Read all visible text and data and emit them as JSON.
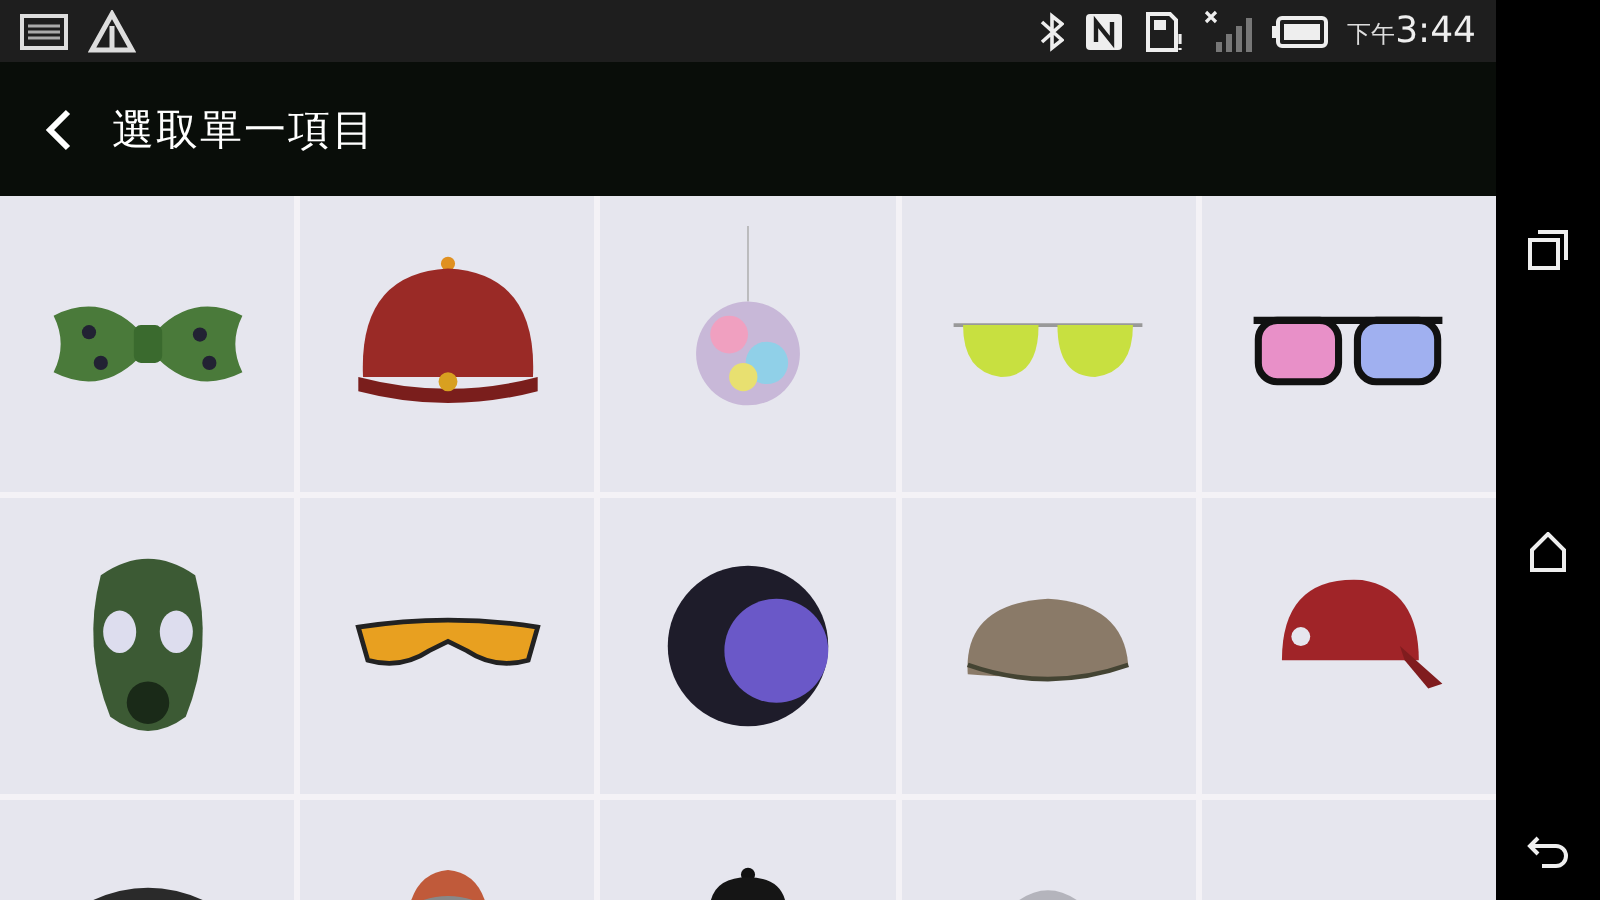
{
  "status_bar": {
    "period": "下午",
    "time": "3:44"
  },
  "app_bar": {
    "title": "選取單一項目"
  },
  "items": [
    {
      "kind": "bowtie"
    },
    {
      "kind": "skullcap"
    },
    {
      "kind": "discoball"
    },
    {
      "kind": "aviators"
    },
    {
      "kind": "pinkglasses"
    },
    {
      "kind": "gasmask"
    },
    {
      "kind": "sportglasses"
    },
    {
      "kind": "afro"
    },
    {
      "kind": "flatcap"
    },
    {
      "kind": "baseballcap"
    },
    {
      "kind": "darkhat"
    },
    {
      "kind": "tweedhat"
    },
    {
      "kind": "blackcap"
    },
    {
      "kind": "palehat"
    },
    {
      "kind": "blank"
    }
  ]
}
